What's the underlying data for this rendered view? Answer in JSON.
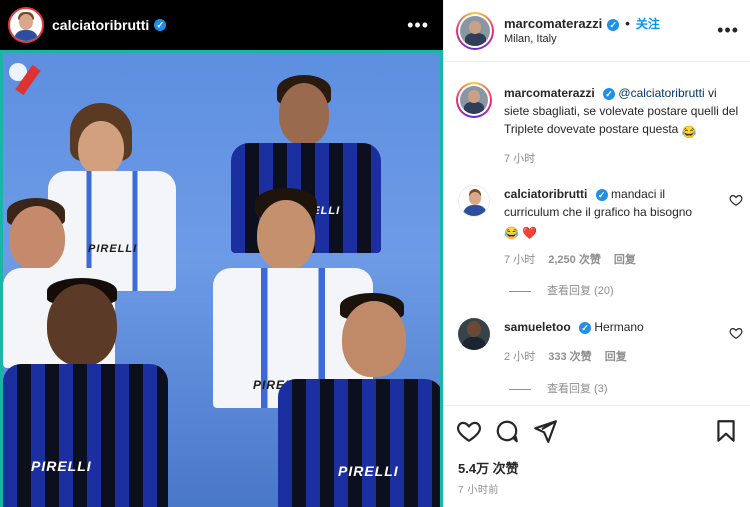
{
  "post": {
    "author": "calciatoribrutti",
    "more_label": "•••",
    "sponsor_text": "PIRELLI",
    "photo_sponsor_labels": [
      "PIRELLI",
      "PIRELLI",
      "PIRELLI",
      "PIRELLI",
      "PIRELLI"
    ]
  },
  "header": {
    "username": "marcomaterazzi",
    "dot": "•",
    "follow_label": "关注",
    "location": "Milan, Italy",
    "more_label": "•••"
  },
  "caption": {
    "username": "marcomaterazzi",
    "mention": "@calciatoribrutti",
    "text": " vi siete sbagliati, se volevate postare quelli del Triplete dovevate postare questa ",
    "emoji": "😂",
    "time": "7 小时"
  },
  "comments": [
    {
      "username": "calciatoribrutti",
      "text": "mandaci il curriculum che il grafico ha bisogno",
      "emoji": "😂 ❤️",
      "time": "7 小时",
      "likes": "2,250 次赞",
      "reply_label": "回复",
      "view_replies": "查看回复 (20)"
    },
    {
      "username": "samueletoo",
      "text": "Hermano",
      "time": "2 小时",
      "likes": "333 次赞",
      "reply_label": "回复",
      "view_replies": "查看回复 (3)"
    }
  ],
  "footer": {
    "likes": "5.4万 次赞",
    "time": "7 小时前"
  },
  "colors": {
    "verified": "#1f8fe8",
    "follow": "#0095f6",
    "border_accent": "#19b6a8",
    "heart": "#e0245e"
  },
  "icons": [
    "verified-icon",
    "heart-icon",
    "comment-icon",
    "share-icon",
    "bookmark-icon",
    "more-icon"
  ]
}
